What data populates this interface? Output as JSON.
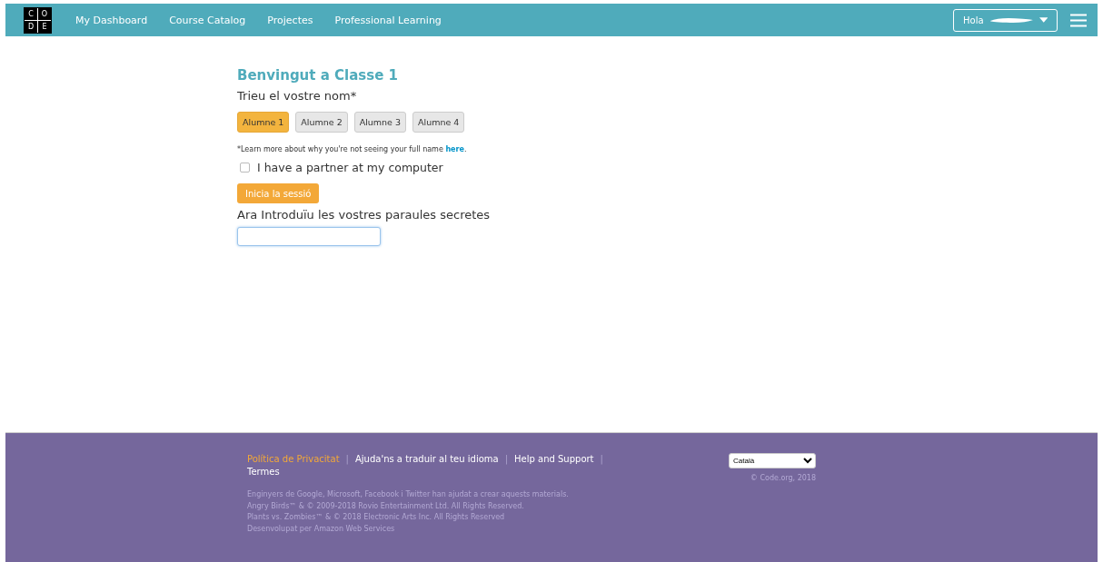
{
  "header": {
    "logo_letters": [
      "C",
      "O",
      "D",
      "E"
    ],
    "nav": [
      "My Dashboard",
      "Course Catalog",
      "Projectes",
      "Professional Learning"
    ],
    "user_button": "Hola"
  },
  "main": {
    "title": "Benvingut a Classe 1",
    "prompt": "Trieu el vostre nom*",
    "names": [
      {
        "label": "Alumne 1",
        "selected": true
      },
      {
        "label": "Alumne 2",
        "selected": false
      },
      {
        "label": "Alumne 3",
        "selected": false
      },
      {
        "label": "Alumne 4",
        "selected": false
      }
    ],
    "note": "*Learn more about why you're not seeing your full name",
    "note_link": "here",
    "note_end": ".",
    "partner": {
      "label": "I have a partner at my computer",
      "checked": false
    },
    "signin_button": "Inicia la sessió",
    "secret_prompt": "Ara Introduïu les vostres paraules secretes"
  },
  "footer": {
    "links": [
      {
        "label": "Política de Privacitat",
        "highlighted": true
      },
      {
        "label": "Ajuda'ns a traduir al teu idioma",
        "highlighted": false
      },
      {
        "label": "Help and Support",
        "highlighted": false
      },
      {
        "label": "Termes",
        "highlighted": false
      }
    ],
    "separators": [
      "|",
      "|",
      "|"
    ],
    "credits": [
      "Enginyers de Google, Microsoft, Facebook i Twitter han ajudat a crear aquests materials.",
      "Angry Birds™ & © 2009-2018 Rovio Entertainment Ltd. All Rights Reserved.",
      "Plants vs. Zombies™ & © 2018 Electronic Arts Inc. All Rights Reserved",
      "Desenvolupat per Amazon Web Services"
    ],
    "language": "Català",
    "copyright": "© Code.org, 2018"
  }
}
